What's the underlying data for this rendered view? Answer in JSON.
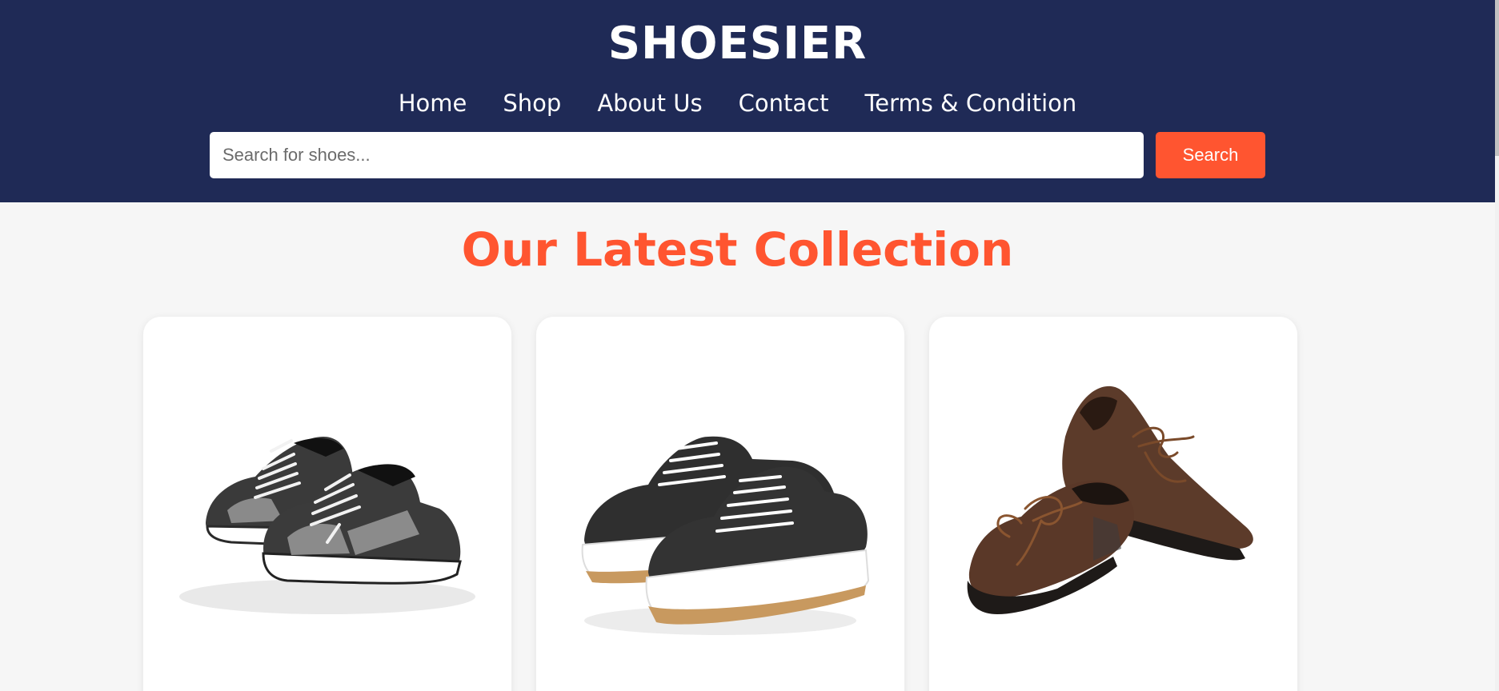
{
  "header": {
    "brand": "SHOESIER",
    "nav": [
      "Home",
      "Shop",
      "About Us",
      "Contact",
      "Terms & Condition"
    ]
  },
  "search": {
    "placeholder": "Search for shoes...",
    "button_label": "Search"
  },
  "main": {
    "title": "Our Latest Collection",
    "products": [
      {
        "image": "grey-black-sneakers-image"
      },
      {
        "image": "black-white-platform-sneakers-image"
      },
      {
        "image": "brown-leather-derby-shoes-image"
      }
    ]
  },
  "colors": {
    "header_bg": "#1f2a56",
    "accent": "#ff5530",
    "page_bg": "#f6f6f6"
  }
}
